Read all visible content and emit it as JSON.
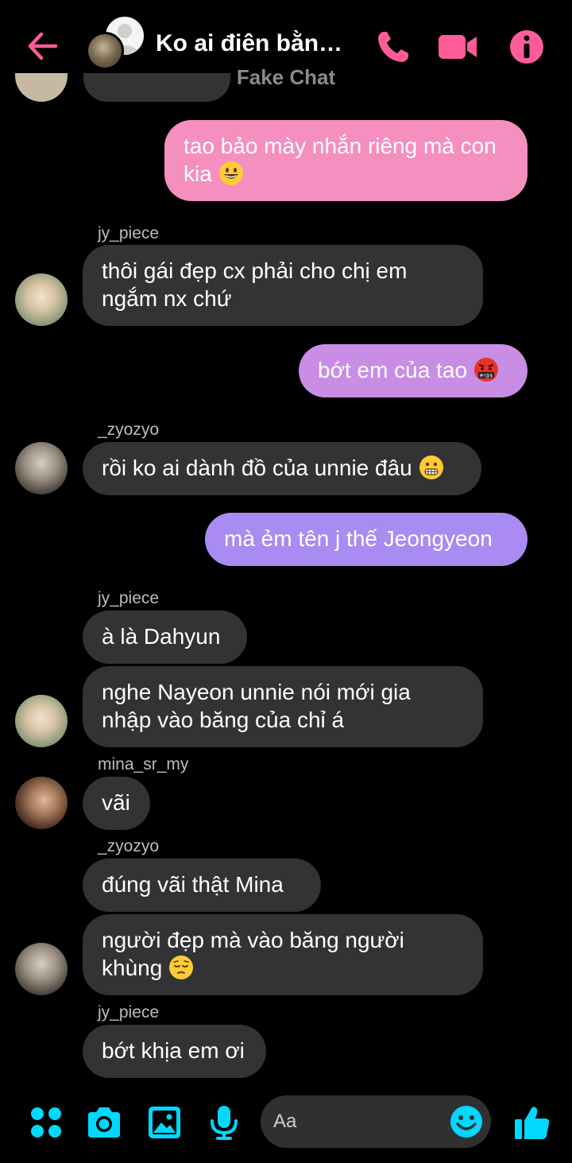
{
  "header": {
    "title": "Ko ai điên bằng ...",
    "subtitle": "Fake Chat",
    "accent_color": "#ff5c9a"
  },
  "messages": [
    {
      "type": "out",
      "text": "tao bảo mày nhắn riêng mà con kia",
      "emoji": "grinning-face-emoji",
      "color": "#f48fc0"
    },
    {
      "type": "in",
      "sender": "jy_piece",
      "text": "thôi gái đẹp cx phải cho chị em ngắm nx chứ"
    },
    {
      "type": "out",
      "text": "bớt em của tao",
      "emoji": "cursing-face-emoji",
      "color": "#c98de6"
    },
    {
      "type": "in",
      "sender": "_zyozyo",
      "text": "rồi ko ai dành đồ của unnie đâu",
      "emoji": "grimacing-face-emoji"
    },
    {
      "type": "out",
      "text": "mà ẻm tên j thế Jeongyeon",
      "color": "#a98bf2"
    },
    {
      "type": "in",
      "sender": "jy_piece",
      "text": "à là Dahyun"
    },
    {
      "type": "in",
      "text": "nghe Nayeon unnie nói mới gia nhập vào băng của chỉ á"
    },
    {
      "type": "in",
      "sender": "mina_sr_my",
      "text": "vãi"
    },
    {
      "type": "in",
      "sender": "_zyozyo",
      "text": "đúng vãi thật Mina"
    },
    {
      "type": "in",
      "text": "người đẹp mà vào băng người khùng",
      "emoji": "pensive-face-emoji"
    },
    {
      "type": "in",
      "sender": "jy_piece",
      "text": "bớt khịa em ơi"
    }
  ],
  "composer": {
    "placeholder": "Aa",
    "icon_color": "#00d8ff",
    "icons": [
      "menu-dots-icon",
      "camera-icon",
      "image-icon",
      "microphone-icon",
      "emoji-icon",
      "thumbs-up-icon"
    ]
  }
}
